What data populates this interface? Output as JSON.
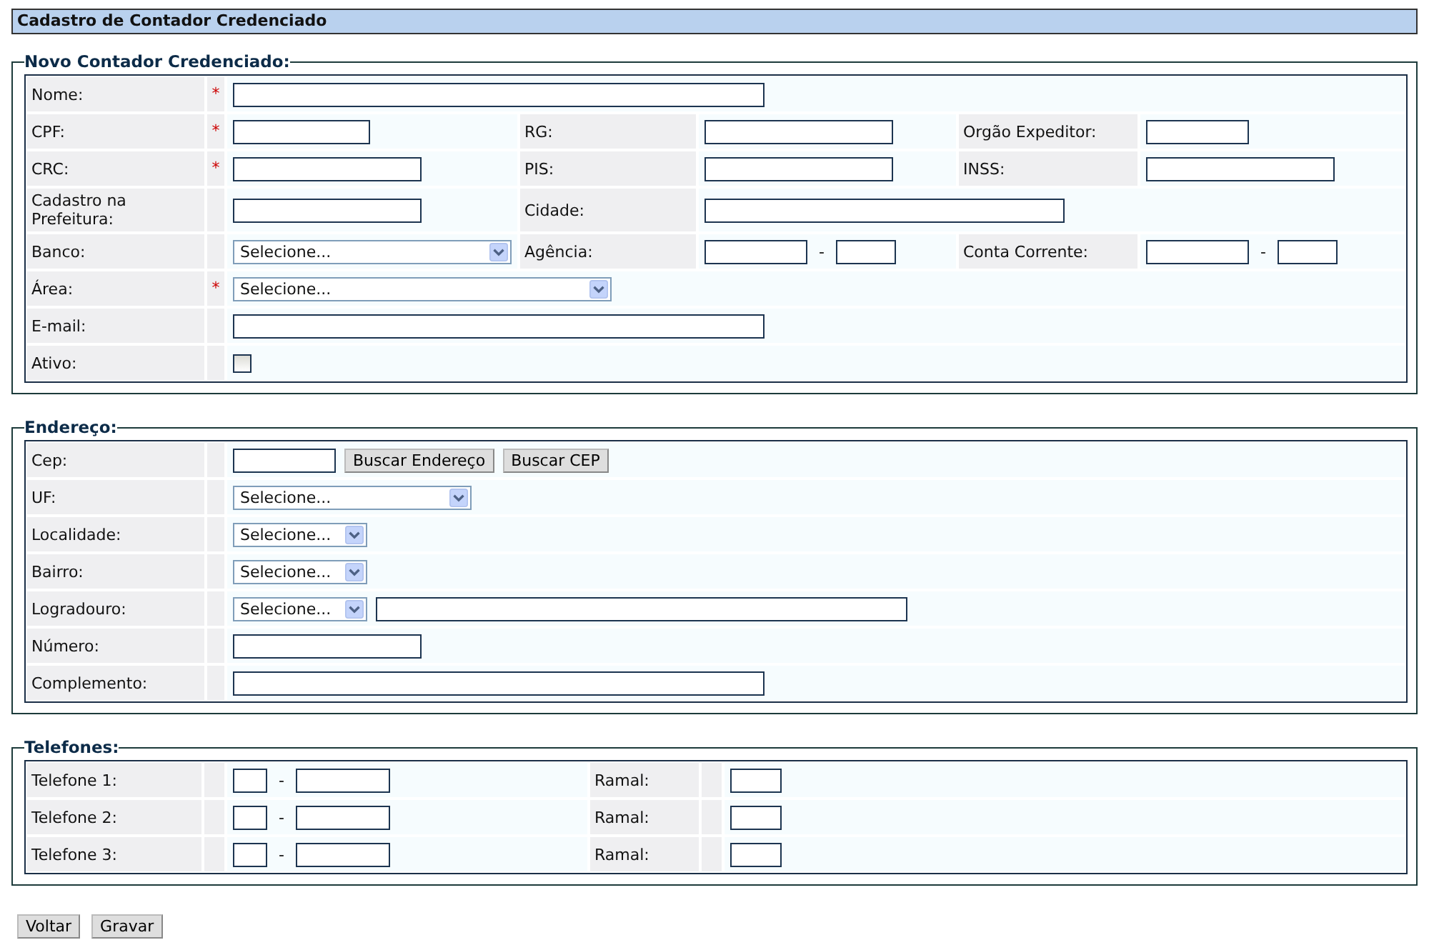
{
  "header": {
    "title": "Cadastro de Contador Credenciado"
  },
  "sections": [
    {
      "kind": "contador",
      "legend": "Novo Contador Credenciado:",
      "rows": [
        {
          "label": "Nome:",
          "mark": "*",
          "controls": [
            {
              "kind": "text"
            }
          ]
        },
        {
          "label": "CPF:",
          "mark": "*",
          "controls": [
            {
              "kind": "text"
            }
          ],
          "extras": [
            {
              "label": "RG:",
              "controls": [
                {
                  "kind": "text"
                }
              ]
            },
            {
              "label": "Orgão Expeditor:",
              "controls": [
                {
                  "kind": "text"
                }
              ]
            }
          ]
        },
        {
          "label": "CRC:",
          "mark": "*",
          "controls": [
            {
              "kind": "text"
            }
          ],
          "extras": [
            {
              "label": "PIS:",
              "controls": [
                {
                  "kind": "text"
                }
              ]
            },
            {
              "label": "INSS:",
              "controls": [
                {
                  "kind": "text"
                }
              ]
            }
          ]
        },
        {
          "label": "Cadastro na Prefeitura:",
          "controls": [
            {
              "kind": "text"
            }
          ],
          "extras": [
            {
              "label": "Cidade:",
              "controls": [
                {
                  "kind": "text"
                }
              ]
            }
          ]
        },
        {
          "label": "Banco:",
          "controls": [
            {
              "kind": "select",
              "value": "Selecione..."
            }
          ],
          "extras": [
            {
              "label": "Agência:",
              "controls": [
                {
                  "kind": "text"
                },
                {
                  "kind": "separator",
                  "text": "-"
                },
                {
                  "kind": "text"
                }
              ]
            },
            {
              "label": "Conta Corrente:",
              "controls": [
                {
                  "kind": "text"
                },
                {
                  "kind": "separator",
                  "text": "-"
                },
                {
                  "kind": "text"
                }
              ]
            }
          ]
        },
        {
          "label": "Área:",
          "mark": "*",
          "controls": [
            {
              "kind": "select",
              "value": "Selecione..."
            }
          ]
        },
        {
          "label": "E-mail:",
          "controls": [
            {
              "kind": "text"
            }
          ]
        },
        {
          "label": "Ativo:",
          "controls": [
            {
              "kind": "checkbox",
              "checked": false
            }
          ]
        }
      ]
    },
    {
      "kind": "endereco",
      "legend": "Endereço:",
      "rows": [
        {
          "label": "Cep:",
          "controls": [
            {
              "kind": "text"
            },
            {
              "kind": "button",
              "text": "Buscar Endereço"
            },
            {
              "kind": "button",
              "text": "Buscar CEP"
            }
          ]
        },
        {
          "label": "UF:",
          "controls": [
            {
              "kind": "select",
              "value": "Selecione..."
            }
          ]
        },
        {
          "label": "Localidade:",
          "controls": [
            {
              "kind": "select",
              "value": "Selecione..."
            }
          ]
        },
        {
          "label": "Bairro:",
          "controls": [
            {
              "kind": "select",
              "value": "Selecione..."
            }
          ]
        },
        {
          "label": "Logradouro:",
          "controls": [
            {
              "kind": "select",
              "value": "Selecione..."
            },
            {
              "kind": "text"
            }
          ]
        },
        {
          "label": "Número:",
          "controls": [
            {
              "kind": "text"
            }
          ]
        },
        {
          "label": "Complemento:",
          "controls": [
            {
              "kind": "text"
            }
          ]
        }
      ]
    },
    {
      "kind": "telefones",
      "legend": "Telefones:",
      "rows": [
        {
          "label": "Telefone 1:",
          "controls": [
            {
              "kind": "text"
            },
            {
              "kind": "separator",
              "text": "-"
            },
            {
              "kind": "text"
            }
          ],
          "extras": [
            {
              "label": "Ramal:",
              "controls": [
                {
                  "kind": "text"
                }
              ]
            }
          ]
        },
        {
          "label": "Telefone 2:",
          "controls": [
            {
              "kind": "text"
            },
            {
              "kind": "separator",
              "text": "-"
            },
            {
              "kind": "text"
            }
          ],
          "extras": [
            {
              "label": "Ramal:",
              "controls": [
                {
                  "kind": "text"
                }
              ]
            }
          ]
        },
        {
          "label": "Telefone 3:",
          "controls": [
            {
              "kind": "text"
            },
            {
              "kind": "separator",
              "text": "-"
            },
            {
              "kind": "text"
            }
          ],
          "extras": [
            {
              "label": "Ramal:",
              "controls": [
                {
                  "kind": "text"
                }
              ]
            }
          ]
        }
      ]
    }
  ],
  "buttons": [
    "Voltar",
    "Gravar"
  ]
}
